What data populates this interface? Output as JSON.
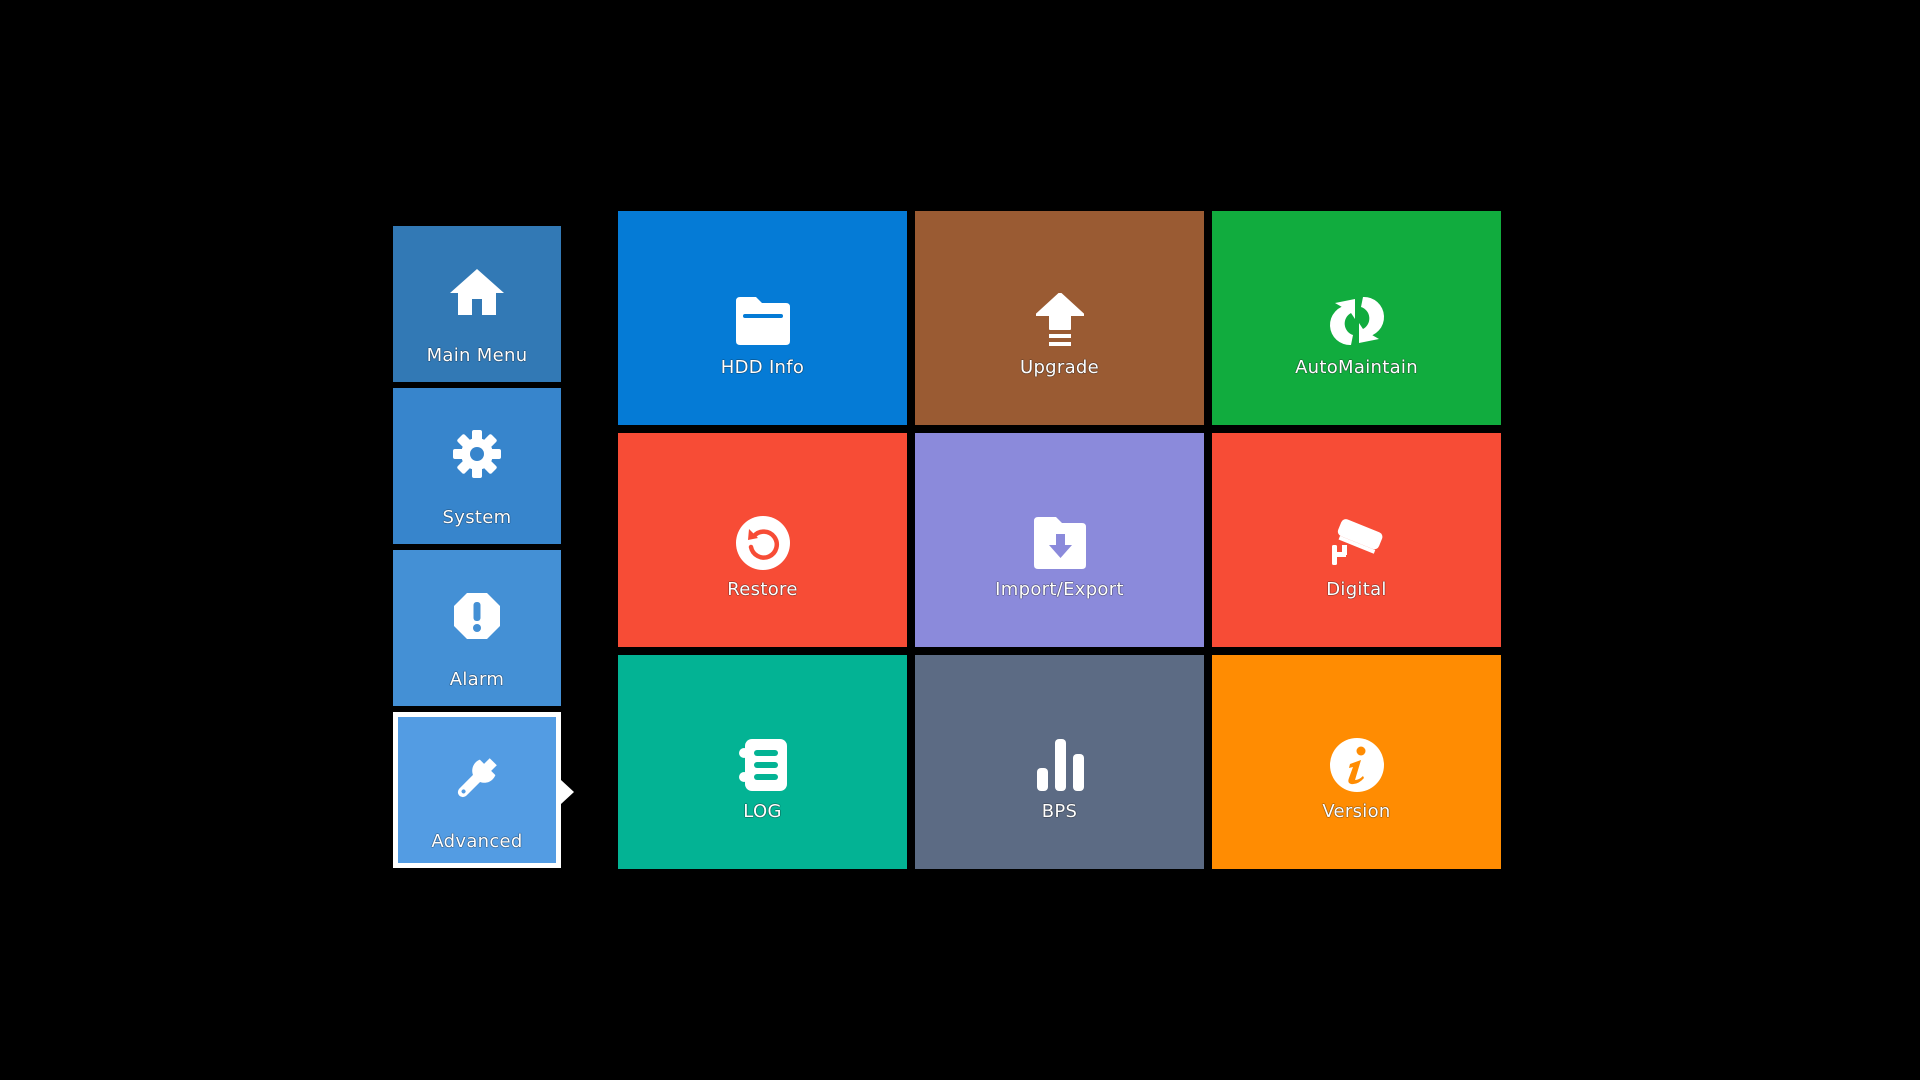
{
  "sidebar": {
    "items": [
      {
        "label": "Main Menu",
        "icon": "home-icon",
        "color": "#3279B5"
      },
      {
        "label": "System",
        "icon": "gear-icon",
        "color": "#3785CC"
      },
      {
        "label": "Alarm",
        "icon": "alert-icon",
        "color": "#4490D5"
      },
      {
        "label": "Advanced",
        "icon": "wrench-icon",
        "color": "#539CE3",
        "active": true
      }
    ]
  },
  "tiles": [
    {
      "label": "HDD Info",
      "icon": "folder-icon",
      "color": "#057BD6"
    },
    {
      "label": "Upgrade",
      "icon": "upload-arrow-icon",
      "color": "#9A5B33"
    },
    {
      "label": "AutoMaintain",
      "icon": "refresh-icon",
      "color": "#11AC3E"
    },
    {
      "label": "Restore",
      "icon": "restore-icon",
      "color": "#F74C36"
    },
    {
      "label": "Import/Export",
      "icon": "folder-download-icon",
      "color": "#8B8ADB"
    },
    {
      "label": "Digital",
      "icon": "camera-icon",
      "color": "#F74C36"
    },
    {
      "label": "LOG",
      "icon": "log-book-icon",
      "color": "#03B394"
    },
    {
      "label": "BPS",
      "icon": "bar-chart-icon",
      "color": "#5C6B84"
    },
    {
      "label": "Version",
      "icon": "info-icon",
      "color": "#FF8C02"
    }
  ]
}
